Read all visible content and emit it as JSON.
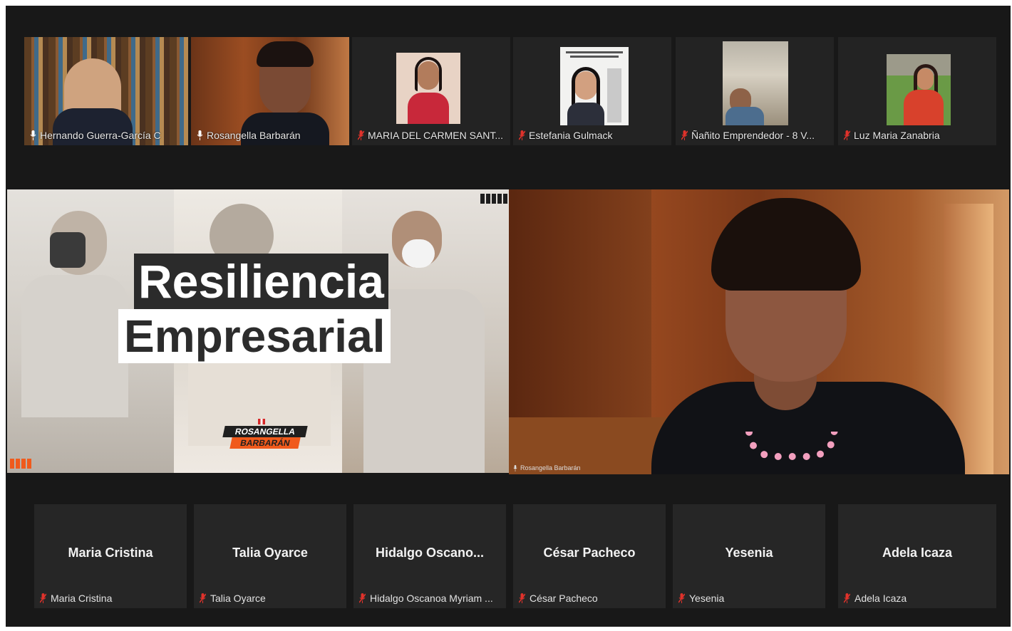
{
  "top_strip": [
    {
      "label": "Hernando Guerra-García C",
      "mic": "mic-on-icon",
      "active": true
    },
    {
      "label": "Rosangella Barbarán",
      "mic": "mic-on-icon",
      "active": false
    },
    {
      "label": "MARIA DEL CARMEN SANT...",
      "mic": "mic-muted-icon",
      "active": false
    },
    {
      "label": "Estefania Gulmack",
      "mic": "mic-muted-icon",
      "active": false
    },
    {
      "label": "Ñañito Emprendedor - 8 V...",
      "mic": "mic-muted-icon",
      "active": false
    },
    {
      "label": "Luz Maria Zanabria",
      "mic": "mic-muted-icon",
      "active": false
    }
  ],
  "presentation": {
    "title_line1": "Resiliencia",
    "title_line2": "Empresarial",
    "logo_line1": "ROSANGELLA",
    "logo_line2": "BARBARÁN"
  },
  "speaker": {
    "label": "Rosangella Barbarán"
  },
  "bottom_strip": [
    {
      "display": "Maria Cristina",
      "label": "Maria Cristina"
    },
    {
      "display": "Talia Oyarce",
      "label": "Talia Oyarce"
    },
    {
      "display": "Hidalgo Oscano...",
      "label": "Hidalgo Oscanoa Myriam ..."
    },
    {
      "display": "César Pacheco",
      "label": "César Pacheco"
    },
    {
      "display": "Yesenia",
      "label": "Yesenia"
    },
    {
      "display": "Adela Icaza",
      "label": "Adela Icaza"
    }
  ],
  "colors": {
    "active_border": "#c8d84a",
    "muted_red": "#e0322b",
    "accent_orange": "#f05a1c"
  }
}
